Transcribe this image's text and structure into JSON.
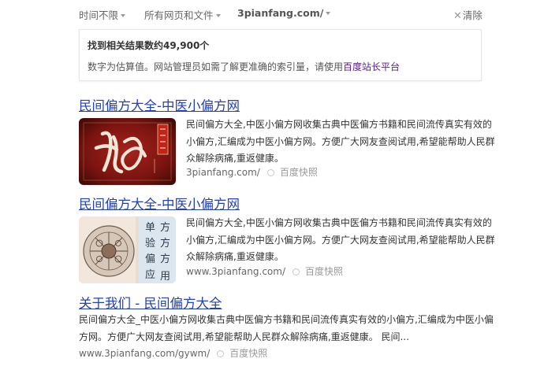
{
  "filters": {
    "time": "时间不限",
    "pages": "所有网页和文件",
    "site": "3pianfang.com/",
    "clear": "清除"
  },
  "summary": {
    "count_text": "找到相关结果数约49,900个",
    "note_text": "数字为估算值。网站管理员如需了解更准确的索引量，请使用",
    "link_text": "百度站长平台"
  },
  "results": [
    {
      "title": "民间偏方大全-中医小偏方网",
      "abstract": "民间偏方大全,中医小偏方网收集古典中医偏方书籍和民间流传真实有效的小偏方,汇编成为中医小偏方网。方便广大网友查阅试用,希望能帮助人民群众解除病痛,重返健康。",
      "url": "3pianfang.com/",
      "snapshot": "百度快照",
      "thumb_icon": "red-calligraphy-thumbnail"
    },
    {
      "title": "民间偏方大全-中医小偏方网",
      "abstract": "民间偏方大全,中医小偏方网收集古典中医偏方书籍和民间流传真实有效的小偏方,汇编成为中医小偏方网。方便广大网友查阅试用,希望能帮助人民群众解除病痛,重返健康。",
      "url": "www.3pianfang.com/",
      "snapshot": "百度快照",
      "thumb_icon": "book-cover-thumbnail",
      "thumb_text": [
        "单",
        "方",
        "验",
        "方",
        "偏",
        "方",
        "应",
        "用"
      ]
    },
    {
      "title": "关于我们 - 民间偏方大全",
      "abstract": "民间偏方大全_中医小偏方网收集古典中医偏方书籍和民间流传真实有效的小偏方,汇编成为中医小偏方网。方便广大网友查阅试用,希望能帮助人民群众解除病痛,重返健康。 民间...",
      "url": "www.3pianfang.com/gywm/",
      "snapshot": "百度快照"
    }
  ],
  "colors": {
    "title_link": "#2440b3",
    "visited_link": "#551a8b",
    "text": "#333333",
    "muted": "#666666"
  }
}
